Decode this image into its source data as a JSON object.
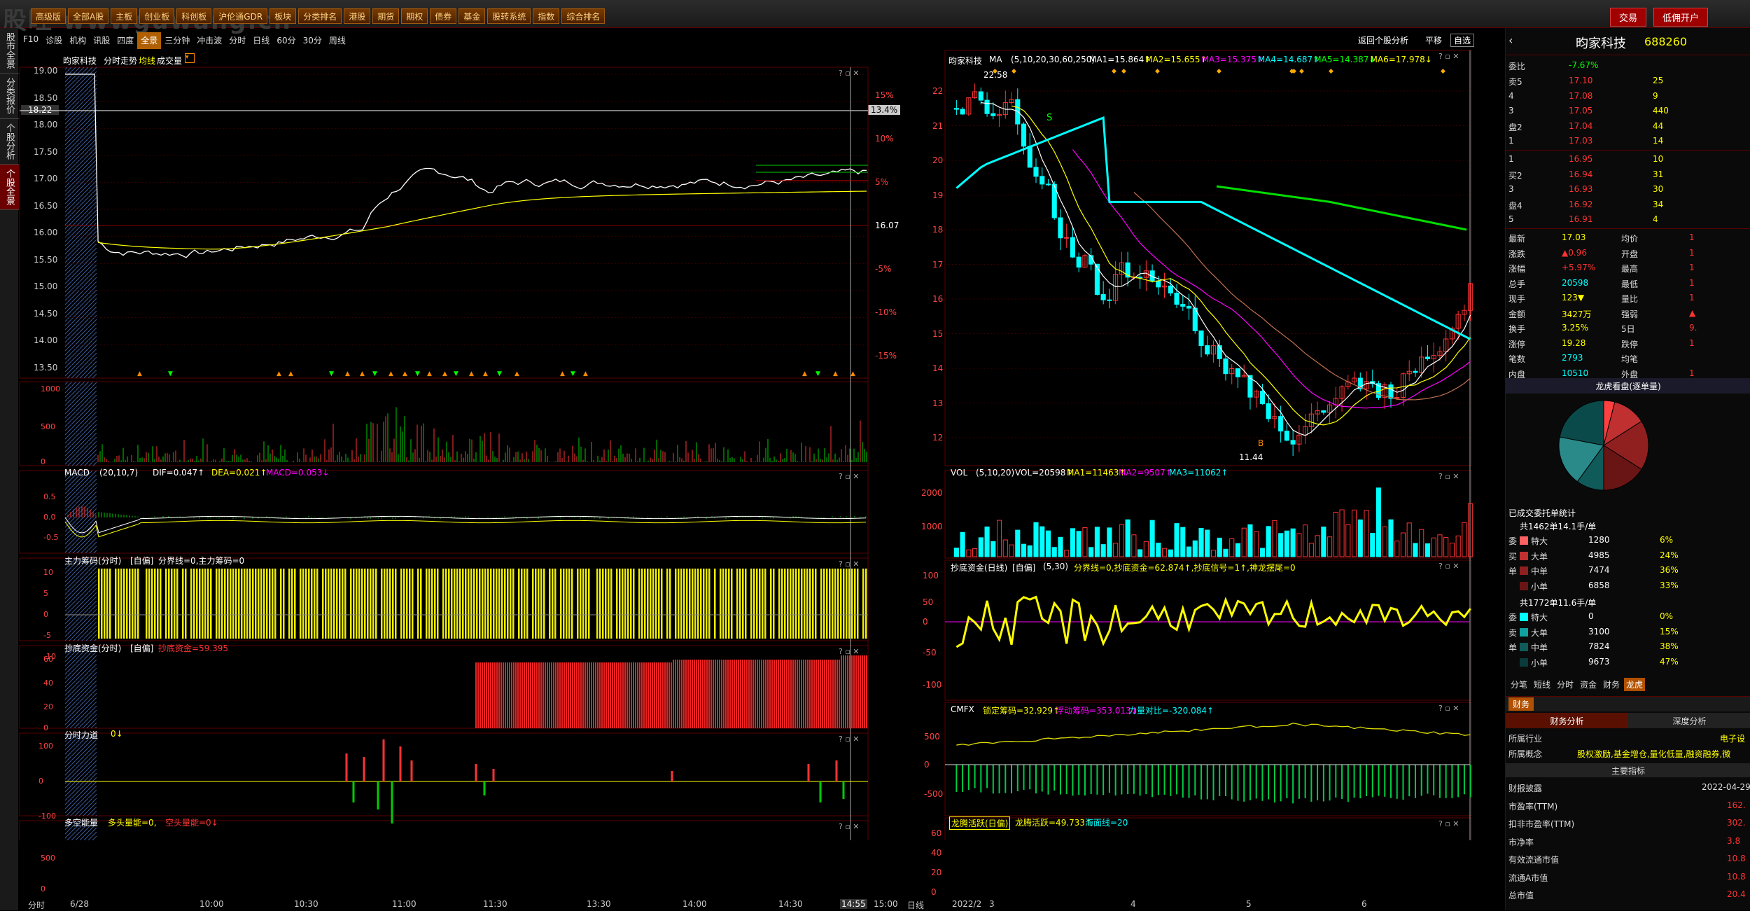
{
  "watermark": "股旺 wwwguwang.cn",
  "topmenu": [
    "高级版",
    "全部A股",
    "主板",
    "创业板",
    "科创板",
    "沪伦通GDR",
    "板块",
    "分类排名",
    "港股",
    "期货",
    "期权",
    "债券",
    "基金",
    "股转系统",
    "指数",
    "综合排名"
  ],
  "topright": [
    "交易",
    "低佣开户"
  ],
  "leftbar": [
    "股市全景",
    "分类报价",
    "个股分析",
    "个股全景"
  ],
  "tabs": [
    "F10",
    "诊股",
    "机构",
    "讯股",
    "四度",
    "全景",
    "三分钟",
    "冲击波",
    "分时",
    "日线",
    "60分",
    "30分",
    "周线"
  ],
  "active_tab": "全景",
  "top_right_links": [
    "返回个股分析",
    "平移",
    "自选"
  ],
  "intraday": {
    "title": "昀家科技",
    "sub": "分时走势",
    "ma": "均线",
    "vol": "成交量",
    "yticks": [
      "19.00",
      "18.50",
      "18.00",
      "17.50",
      "17.00",
      "16.50",
      "16.00",
      "15.50",
      "15.00",
      "14.50",
      "14.00",
      "13.50"
    ],
    "pct": [
      "15%",
      "10%",
      "5%",
      "16.07",
      "-5%",
      "-10%",
      "-15%"
    ],
    "cur_price": "18.22",
    "cur_pct": "13.4%",
    "times": [
      "分时",
      "6/28",
      "10:00",
      "10:30",
      "11:00",
      "11:30",
      "13:30",
      "14:00",
      "14:30",
      "14:55",
      "15:00"
    ],
    "vol_ticks": [
      "1000",
      "500",
      "0"
    ]
  },
  "macd": {
    "label": "MACD",
    "params": "(20,10,7)",
    "dif": "DIF=0.047↑",
    "dea": "DEA=0.021↑",
    "macd": "MACD=0.053↓",
    "ticks": [
      "0.5",
      "0.0",
      "-0.5"
    ]
  },
  "zlcm": {
    "label": "主力筹码(分时)",
    "mode": "[自偏]",
    "a": "分界线=0,主力筹码=0",
    "ticks": [
      "10",
      "5",
      "0",
      "-5",
      "-10"
    ]
  },
  "cdzj": {
    "label": "抄底资金(分时)",
    "mode": "[自偏]",
    "a": "抄底资金=59.395",
    "ticks": [
      "60",
      "40",
      "20",
      "0"
    ]
  },
  "fsld": {
    "label": "分时力道",
    "a": "0↓",
    "ticks": [
      "100",
      "0",
      "-100"
    ]
  },
  "dkn": {
    "label": "多空能量",
    "a": "多头量能=0,",
    "b": "空头量能=0↓",
    "ticks": [
      "500",
      "0"
    ]
  },
  "kline": {
    "title": "昀家科技",
    "ma_label": "MA",
    "params": "(5,10,20,30,60,250)",
    "ma": [
      "MA1=15.864↑",
      "MA2=15.655↑",
      "MA3=15.375↑",
      "MA4=14.687↑",
      "MA5=14.387↓",
      "MA6=17.978↓"
    ],
    "yticks": [
      "22",
      "21",
      "20",
      "19",
      "18",
      "17",
      "16",
      "15",
      "14",
      "13",
      "12"
    ],
    "high": "22.58",
    "low": "11.44",
    "dates": [
      "日线",
      "2022/2",
      "3",
      "4",
      "5",
      "6"
    ]
  },
  "vol": {
    "label": "VOL",
    "params": "(5,10,20)",
    "v": "VOL=20598↑",
    "ma1": "MA1=11463↑",
    "ma2": "MA2=9507↑",
    "ma3": "MA3=11062↑",
    "ticks": [
      "2000",
      "1000"
    ]
  },
  "cdzjd": {
    "label": "抄底资金(日线)",
    "mode": "[自偏]",
    "params": "(5,30)",
    "a": "分界线=0,抄底资金=62.874↑,抄底信号=1↑,神龙摆尾=0",
    "ticks": [
      "100",
      "50",
      "0",
      "-50",
      "-100"
    ]
  },
  "cmfx": {
    "label": "CMFX",
    "a": "锁定筹码=32.929↑",
    "b": "浮动筹码=353.013↓",
    "c": "力量对比=-320.084↑",
    "ticks": [
      "500",
      "0",
      "-500"
    ]
  },
  "lthy": {
    "label": "龙腾活跃(日偏)",
    "a": "龙腾活跃=49.733↑",
    "b": "海面线=20",
    "ticks": [
      "60",
      "40",
      "20",
      "0"
    ]
  },
  "quote": {
    "name": "昀家科技",
    "code": "688260",
    "wb_label": "委比",
    "wb": "-7.67%",
    "sells": [
      [
        "卖5",
        "17.10",
        "25"
      ],
      [
        "4",
        "17.08",
        "9"
      ],
      [
        "3",
        "17.05",
        "440"
      ],
      [
        "盘2",
        "17.04",
        "44"
      ],
      [
        "1",
        "17.03",
        "14"
      ]
    ],
    "buys": [
      [
        "1",
        "16.95",
        "10"
      ],
      [
        "买2",
        "16.94",
        "31"
      ],
      [
        "3",
        "16.93",
        "30"
      ],
      [
        "盘4",
        "16.92",
        "34"
      ],
      [
        "5",
        "16.91",
        "4"
      ]
    ],
    "stats": [
      [
        "最新",
        "17.03",
        "均价",
        "1"
      ],
      [
        "涨跌",
        "▲0.96",
        "开盘",
        "1"
      ],
      [
        "涨幅",
        "+5.97%",
        "最高",
        "1"
      ],
      [
        "总手",
        "20598",
        "最低",
        "1"
      ],
      [
        "现手",
        "123▼",
        "量比",
        "1"
      ],
      [
        "金额",
        "3427万",
        "强弱",
        "▲"
      ],
      [
        "换手",
        "3.25%",
        "5日",
        "9."
      ],
      [
        "涨停",
        "19.28",
        "跌停",
        "1"
      ],
      [
        "笔数",
        "2793",
        "均笔",
        ""
      ],
      [
        "内盘",
        "10510",
        "外盘",
        "1"
      ]
    ],
    "pie_title": "龙虎看盘(逐单量)",
    "deal_title": "已成交委托单统计",
    "buy_total": "共1462单14.1手/单",
    "buy_rows": [
      [
        "委",
        "特大",
        "1280",
        "6%"
      ],
      [
        "买",
        "大单",
        "4985",
        "24%"
      ],
      [
        "单",
        "中单",
        "7474",
        "36%"
      ],
      [
        "",
        "小单",
        "6858",
        "33%"
      ]
    ],
    "sell_total": "共1772单11.6手/单",
    "sell_rows": [
      [
        "委",
        "特大",
        "0",
        "0%"
      ],
      [
        "卖",
        "大单",
        "3100",
        "15%"
      ],
      [
        "单",
        "中单",
        "7824",
        "38%"
      ],
      [
        "",
        "小单",
        "9673",
        "47%"
      ]
    ],
    "bottom_tabs": [
      "分笔",
      "短线",
      "分时",
      "资金",
      "财务",
      "龙虎"
    ],
    "fin_tab": "财务",
    "fin_a": "财务分析",
    "fin_b": "深度分析",
    "industry_label": "所属行业",
    "industry": "电子设",
    "concept_label": "所属概念",
    "concept": "股权激励,基金增仓,量化低量,融资融券,微",
    "main_index": "主要指标",
    "report_label": "财报披露",
    "report": "2022-04-29",
    "pe_ttm_label": "市盈率(TTM)",
    "pe_ttm": "162.",
    "pe_ttm2_label": "扣非市盈率(TTM)",
    "pe_ttm2": "302.",
    "pb_label": "市净率",
    "pb": "3.8",
    "float_mv_label": "有效流通市值",
    "float_mv": "10.8",
    "float_a_label": "流通A市值",
    "float_a": "10.8",
    "total_mv_label": "总市值",
    "total_mv": "20.4"
  },
  "colors": {
    "up": "#ff3333",
    "down": "#00ffff",
    "ma5": "#ffffff",
    "ma10": "#ffff00",
    "ma20": "#ff00ff",
    "ma60": "#00ffff",
    "ma250": "#00ff00"
  }
}
